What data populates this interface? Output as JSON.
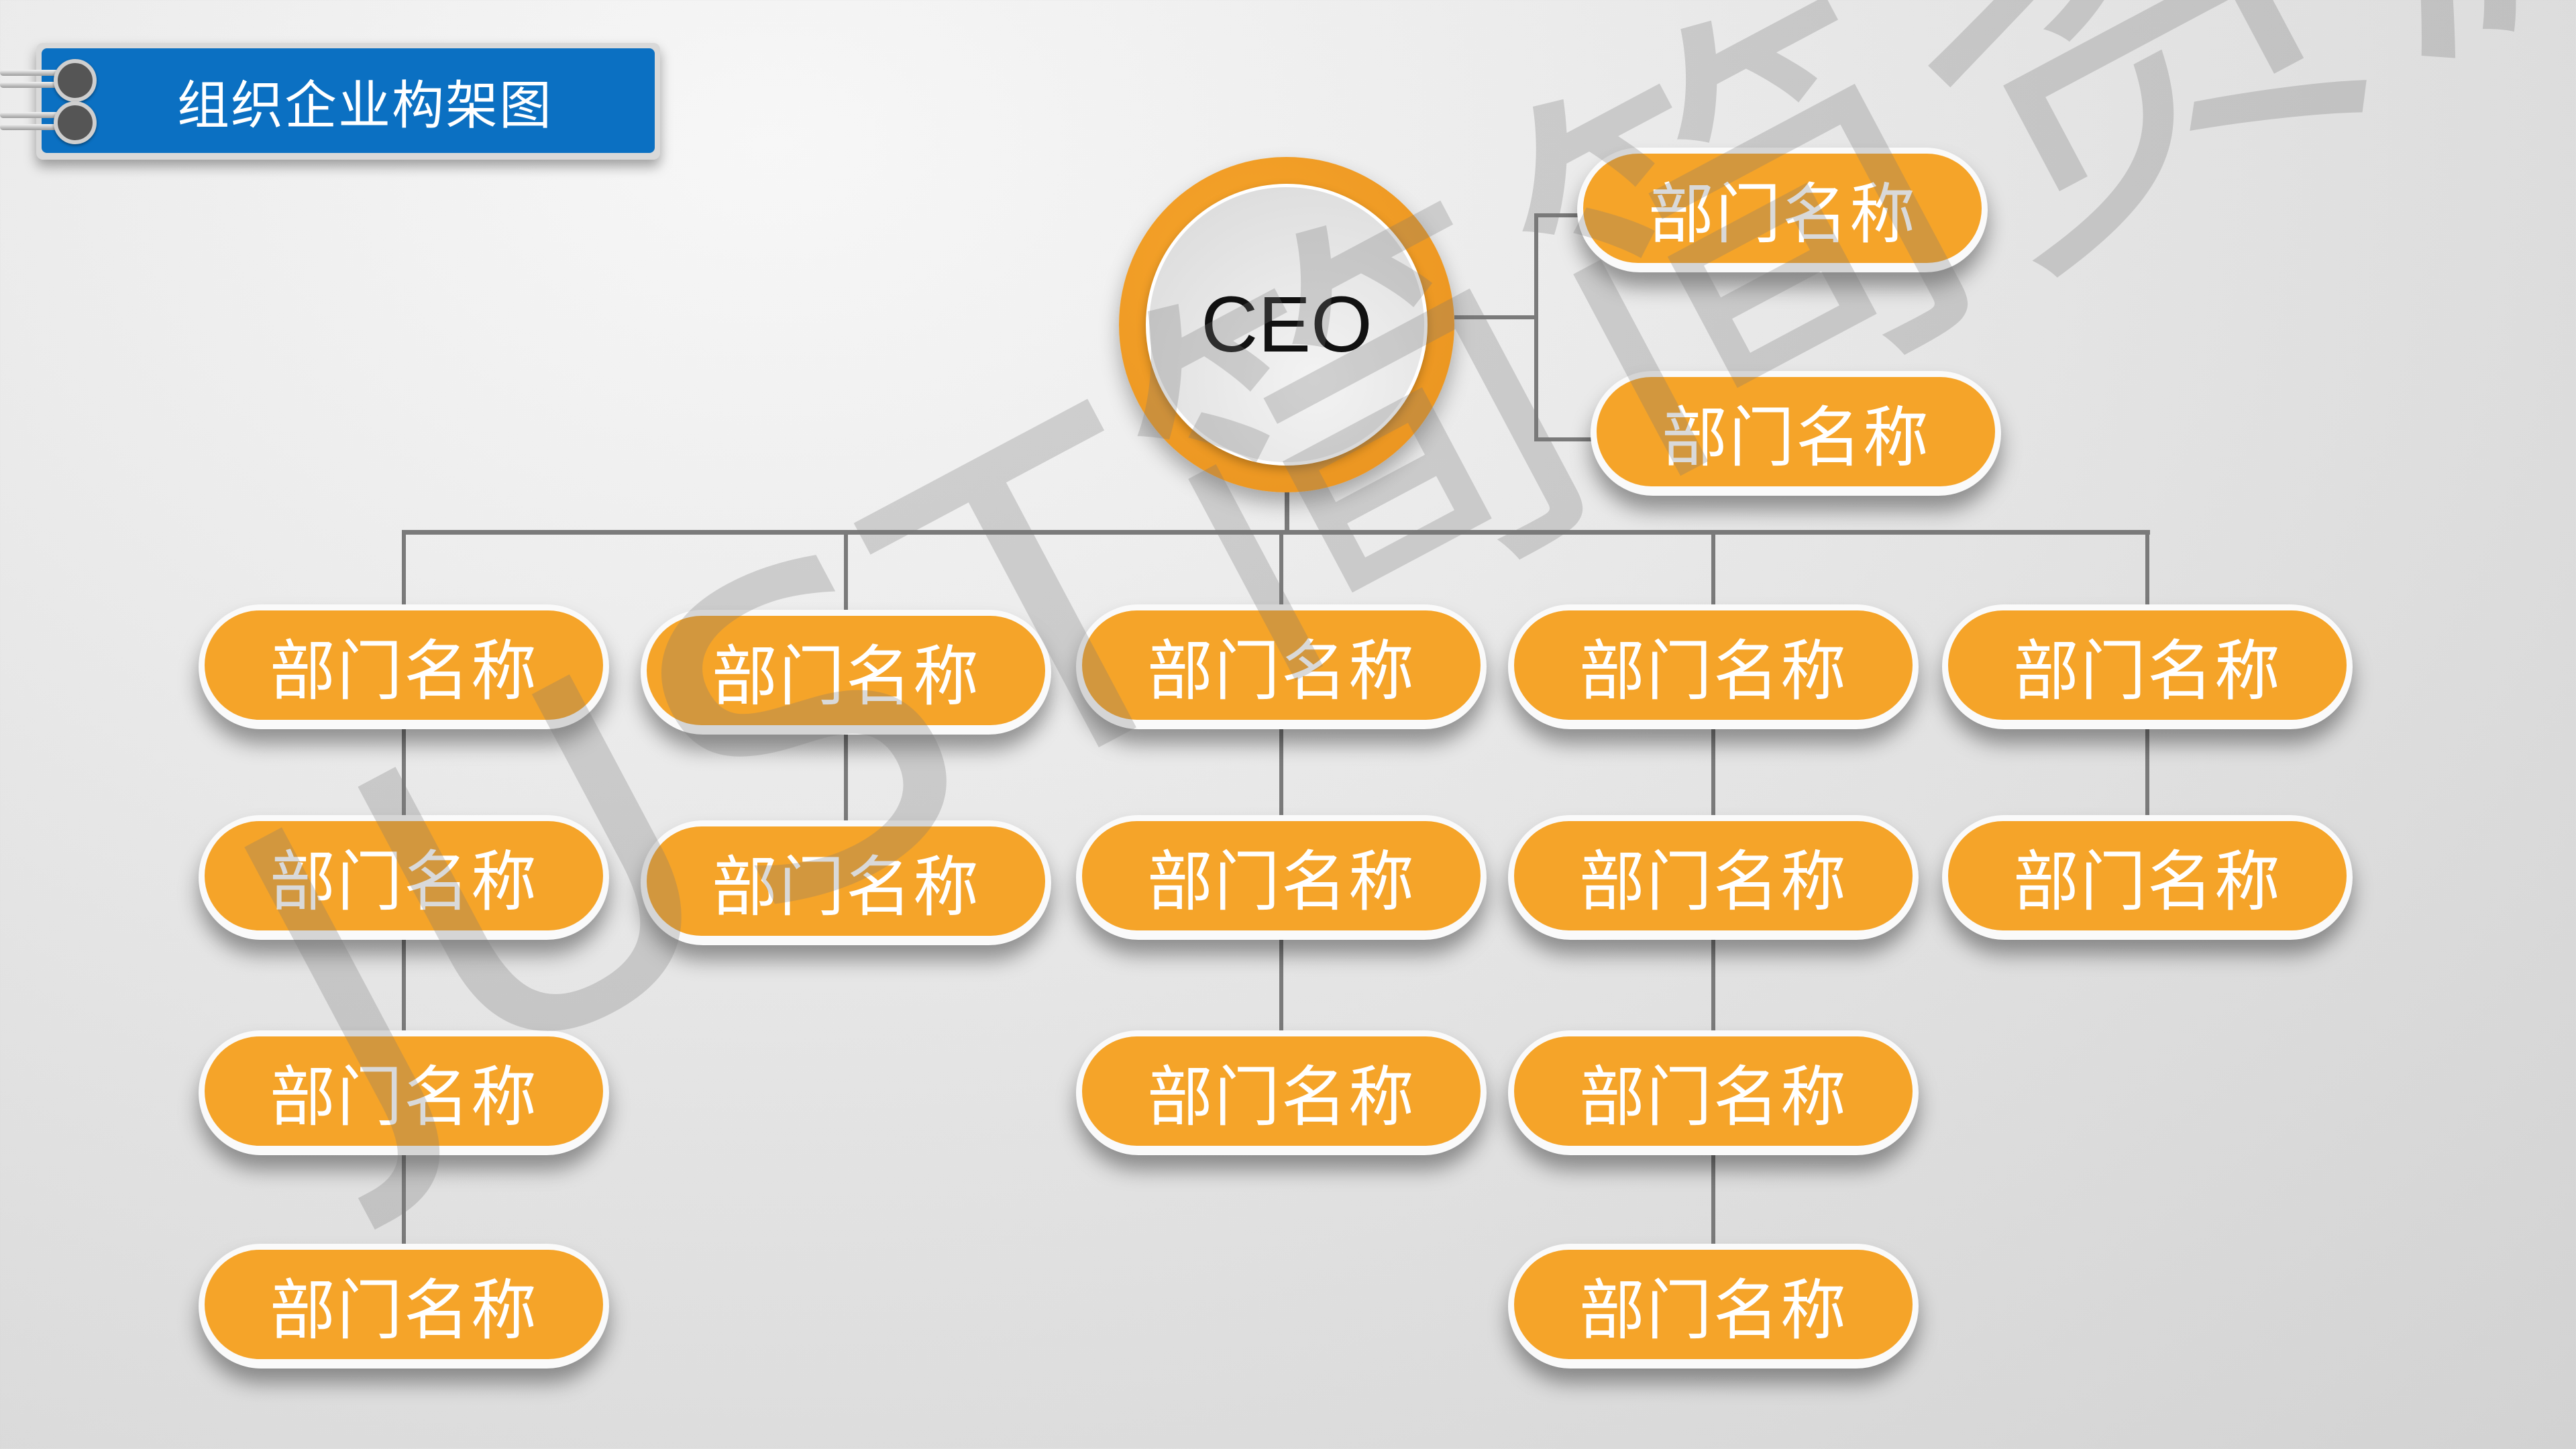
{
  "title": "组织企业构架图",
  "watermark": "JUST简简资源馆",
  "colors": {
    "accent": "#f5a429",
    "banner": "#0b70c2",
    "connector": "#7a7a7a"
  },
  "ceo": {
    "label": "CEO"
  },
  "assistants": [
    {
      "label": "部门名称"
    },
    {
      "label": "部门名称"
    }
  ],
  "columns": [
    {
      "departments": [
        {
          "label": "部门名称"
        },
        {
          "label": "部门名称"
        },
        {
          "label": "部门名称"
        },
        {
          "label": "部门名称"
        }
      ]
    },
    {
      "departments": [
        {
          "label": "部门名称"
        },
        {
          "label": "部门名称"
        }
      ]
    },
    {
      "departments": [
        {
          "label": "部门名称"
        },
        {
          "label": "部门名称"
        },
        {
          "label": "部门名称"
        }
      ]
    },
    {
      "departments": [
        {
          "label": "部门名称"
        },
        {
          "label": "部门名称"
        },
        {
          "label": "部门名称"
        },
        {
          "label": "部门名称"
        }
      ]
    },
    {
      "departments": [
        {
          "label": "部门名称"
        },
        {
          "label": "部门名称"
        }
      ]
    }
  ]
}
